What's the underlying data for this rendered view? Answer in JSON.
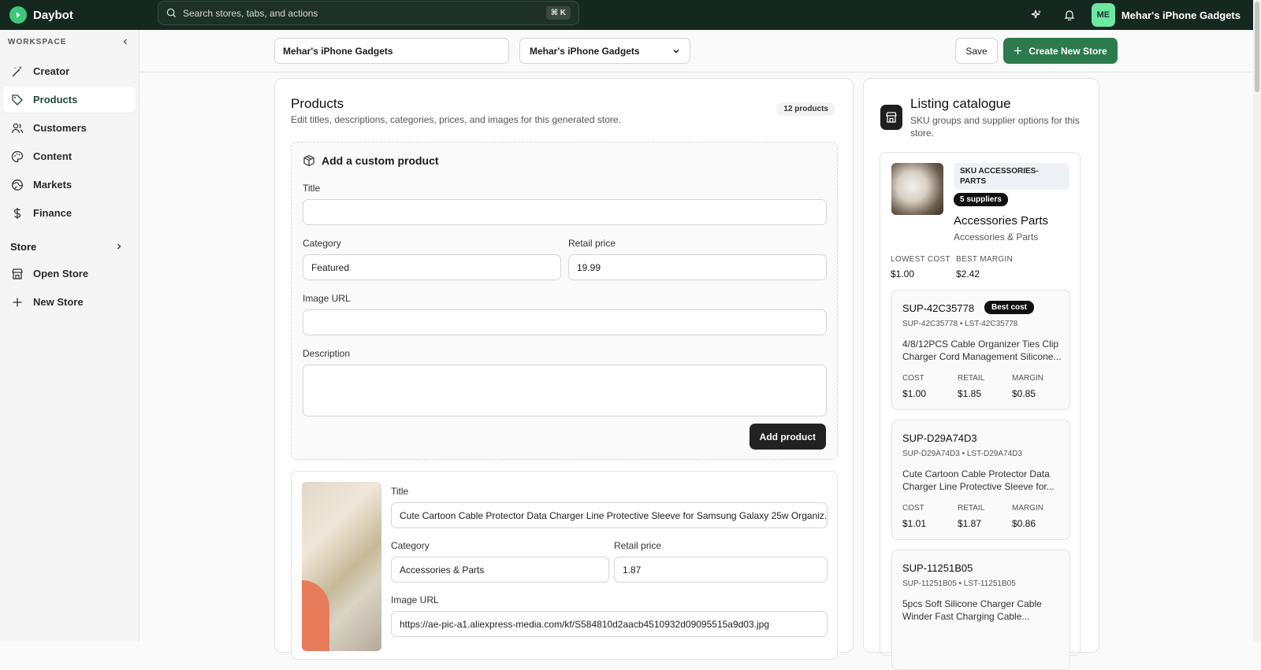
{
  "app": {
    "name": "Daybot"
  },
  "search": {
    "placeholder": "Search stores, tabs, and actions",
    "shortcut": "⌘ K"
  },
  "user": {
    "initials": "ME",
    "name": "Mehar's iPhone Gadgets"
  },
  "sidebar": {
    "workspace_label": "WORKSPACE",
    "items": [
      {
        "label": "Creator",
        "icon": "wand-icon"
      },
      {
        "label": "Products",
        "icon": "tag-icon",
        "active": true
      },
      {
        "label": "Customers",
        "icon": "users-icon"
      },
      {
        "label": "Content",
        "icon": "palette-icon"
      },
      {
        "label": "Markets",
        "icon": "globe-icon"
      },
      {
        "label": "Finance",
        "icon": "dollar-icon"
      }
    ],
    "store_label": "Store",
    "store_items": [
      {
        "label": "Open Store",
        "icon": "storefront-icon"
      },
      {
        "label": "New Store",
        "icon": "plus-icon"
      }
    ]
  },
  "header": {
    "store_name_value": "Mehar's iPhone Gadgets",
    "store_select_value": "Mehar's iPhone Gadgets",
    "save_label": "Save",
    "create_label": "Create New Store"
  },
  "products": {
    "title": "Products",
    "subtitle": "Edit titles, descriptions, categories, prices, and images for this generated store.",
    "count": "12 products",
    "custom": {
      "title": "Add a custom product",
      "title_label": "Title",
      "title_value": "",
      "category_label": "Category",
      "category_value": "Featured",
      "price_label": "Retail price",
      "price_value": "19.99",
      "image_label": "Image URL",
      "image_value": "",
      "description_label": "Description",
      "add_label": "Add product"
    },
    "item": {
      "title_label": "Title",
      "title_value": "Cute Cartoon Cable Protector Data Charger Line Protective Sleeve for Samsung Galaxy 25w Organiz.",
      "category_label": "Category",
      "category_value": "Accessories & Parts",
      "price_label": "Retail price",
      "price_value": "1.87",
      "image_label": "Image URL",
      "image_value": "https://ae-pic-a1.aliexpress-media.com/kf/S584810d2aacb4510932d09095515a9d03.jpg"
    }
  },
  "catalogue": {
    "title": "Listing catalogue",
    "subtitle": "SKU groups and supplier options for this store.",
    "group": {
      "sku": "SKU ACCESSORIES-PARTS",
      "suppliers": "5 suppliers",
      "name": "Accessories Parts",
      "category": "Accessories & Parts",
      "lowest_cost_label": "LOWEST COST",
      "lowest_cost": "$1.00",
      "best_margin_label": "BEST MARGIN",
      "best_margin": "$2.42"
    },
    "cost_label": "COST",
    "retail_label": "RETAIL",
    "margin_label": "MARGIN",
    "best_cost_label": "Best cost",
    "suppliers": [
      {
        "name": "SUP-42C35778",
        "ids": "SUP-42C35778 • LST-42C35778",
        "desc1": "4/8/12PCS Cable Organizer Ties Clip",
        "desc2": "Charger Cord Management Silicone...",
        "cost": "$1.00",
        "retail": "$1.85",
        "margin": "$0.85"
      },
      {
        "name": "SUP-D29A74D3",
        "ids": "SUP-D29A74D3 • LST-D29A74D3",
        "desc1": "Cute Cartoon Cable Protector Data",
        "desc2": "Charger Line Protective Sleeve for...",
        "cost": "$1.01",
        "retail": "$1.87",
        "margin": "$0.86"
      },
      {
        "name": "SUP-11251B05",
        "ids": "SUP-11251B05 • LST-11251B05",
        "desc1": "5pcs Soft Silicone Charger Cable",
        "desc2": "Winder Fast Charging Cable...",
        "cost": "",
        "retail": "",
        "margin": ""
      }
    ]
  }
}
